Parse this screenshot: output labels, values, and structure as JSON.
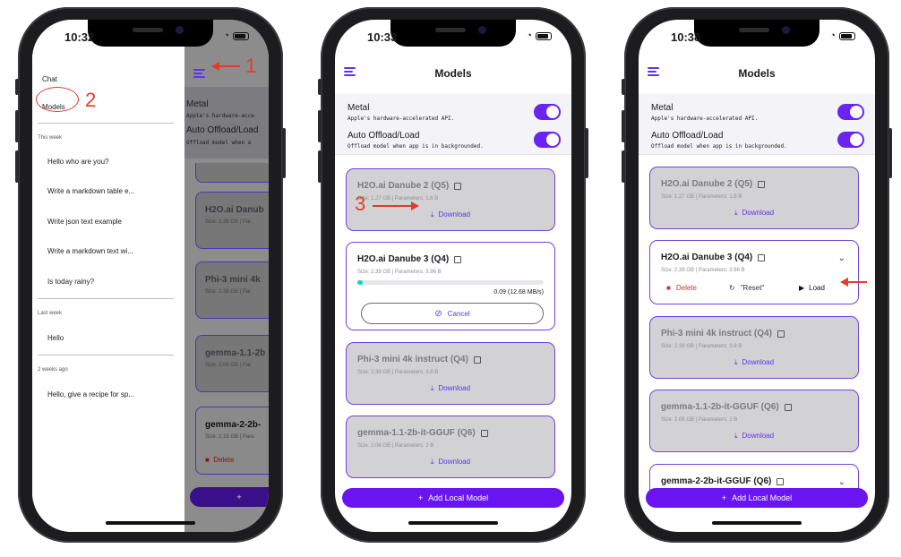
{
  "phone1": {
    "time": "10:32",
    "drawer": {
      "chat_label": "Chat",
      "models_label": "Models",
      "sections": [
        {
          "title": "This week",
          "items": [
            "Hello who are you?",
            "Write a markdown table e...",
            "Write json text example",
            "Write a markdown text wi...",
            "Is today rainy?"
          ]
        },
        {
          "title": "Last week",
          "items": [
            "Hello"
          ]
        },
        {
          "title": "2 weeks ago",
          "items": [
            "Hello, give a recipe for sp..."
          ]
        }
      ]
    },
    "behind": {
      "metal": "Metal",
      "metal_desc": "Apple's hardware-acce",
      "auto": "Auto Offload/Load",
      "auto_desc": "Offload model when a",
      "card1_name": "H2O.ai Danub",
      "card1_meta": "Size: 2.39 GB | Par",
      "card2_name": "Phi-3 mini 4k",
      "card2_meta": "Size: 2.39 GB | Par",
      "card3_name": "gemma-1.1-2b",
      "card3_meta": "Size: 2.06 GB | Par",
      "card4_name": "gemma-2-2b-",
      "card4_meta": "Size: 2.15 GB | Para",
      "delete": "Delete",
      "add_partial": "+"
    },
    "annotations": {
      "one": "1",
      "two": "2"
    }
  },
  "phone2": {
    "time": "10:33",
    "title": "Models",
    "metal": "Metal",
    "metal_desc": "Apple's hardware-accelerated API.",
    "auto": "Auto Offload/Load",
    "auto_desc": "Offload model when app is in backgrounded.",
    "cards": [
      {
        "name": "H2O.ai Danube 2 (Q5)",
        "meta": "Size: 1.27 GB | Parameters: 1.8 B",
        "action": "Download"
      },
      {
        "name": "H2O.ai Danube 3 (Q4)",
        "meta": "Size: 2.39 GB | Parameters: 3.96 B",
        "progress": 0.03,
        "progress_text": "0.09  (12.68 MB/s)",
        "action": "Cancel"
      },
      {
        "name": "Phi-3 mini 4k instruct (Q4)",
        "meta": "Size: 2.39 GB | Parameters: 3.8 B",
        "action": "Download"
      },
      {
        "name": "gemma-1.1-2b-it-GGUF (Q6)",
        "meta": "Size: 2.06 GB | Parameters: 2 B",
        "action": "Download"
      }
    ],
    "add_label": "Add Local Model",
    "annotation": "3"
  },
  "phone3": {
    "time": "10:38",
    "title": "Models",
    "metal": "Metal",
    "metal_desc": "Apple's hardware-accelerated API.",
    "auto": "Auto Offload/Load",
    "auto_desc": "Offload model when app is in backgrounded.",
    "cards": [
      {
        "name": "H2O.ai Danube 2 (Q5)",
        "meta": "Size: 1.27 GB | Parameters: 1.8 B",
        "action": "Download"
      },
      {
        "name": "H2O.ai Danube 3 (Q4)",
        "meta": "Size: 2.39 GB | Parameters: 3.96 B",
        "delete": "Delete",
        "reset": "\"Reset\"",
        "load": "Load"
      },
      {
        "name": "Phi-3 mini 4k instruct (Q4)",
        "meta": "Size: 2.39 GB | Parameters: 3.8 B",
        "action": "Download"
      },
      {
        "name": "gemma-1.1-2b-it-GGUF (Q6)",
        "meta": "Size: 2.06 GB | Parameters: 2 B",
        "action": "Download"
      },
      {
        "name": "gemma-2-2b-it-GGUF (Q6)"
      }
    ],
    "add_label": "Add Local Model"
  },
  "colors": {
    "accent": "#6a14f2",
    "annotation": "#e53a2a",
    "delete": "#c0392b",
    "progress": "#18d1c8"
  }
}
